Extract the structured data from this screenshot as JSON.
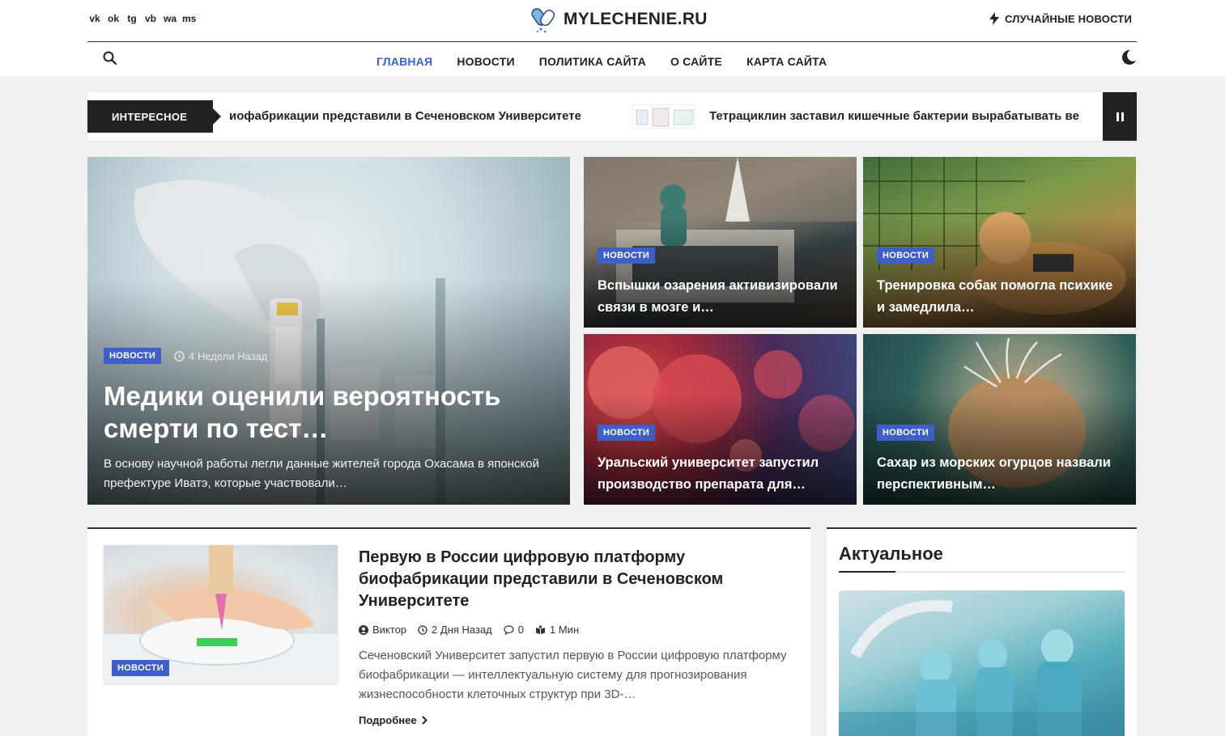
{
  "header": {
    "social_icons": [
      "vk-icon",
      "ok-icon",
      "telegram-icon",
      "viber-icon",
      "whatsapp-icon",
      "messenger-icon"
    ],
    "social_glyphs": [
      "vk",
      "ok",
      "tg",
      "vb",
      "wa",
      "ms"
    ],
    "logo_text": "MYLECHENIE.RU",
    "random_news": "СЛУЧАЙНЫЕ НОВОСТИ"
  },
  "nav": {
    "items": [
      "ГЛАВНАЯ",
      "НОВОСТИ",
      "ПОЛИТИКА САЙТА",
      "О САЙТЕ",
      "КАРТА САЙТА"
    ],
    "active_index": 0
  },
  "ticker": {
    "label": "ИНТЕРЕСНОЕ",
    "items": [
      "иофабрикации представили в Сеченовском Университете",
      "Тетрациклин заставил кишечные бактерии вырабатывать ве"
    ]
  },
  "hero": {
    "main": {
      "category": "НОВОСТИ",
      "time": "4 Недели Назад",
      "title": "Медики оценили вероятность смерти по тест…",
      "excerpt": "В основу научной работы легли данные жителей города Охасама в японской префектуре Иватэ, которые участвовали…"
    },
    "cards": [
      {
        "category": "НОВОСТИ",
        "title": "Вспышки озарения активизировали связи в мозге и…"
      },
      {
        "category": "НОВОСТИ",
        "title": "Тренировка собак помогла психике и замедлила…"
      },
      {
        "category": "НОВОСТИ",
        "title": "Уральский университет запустил производство препарата для…"
      },
      {
        "category": "НОВОСТИ",
        "title": "Сахар из морских огурцов назвали перспективным…"
      }
    ]
  },
  "post": {
    "category": "НОВОСТИ",
    "title": "Первую в России цифровую платформу биофабрикации представили в Сеченовском Университете",
    "author": "Виктор",
    "date": "2 Дня Назад",
    "comments": "0",
    "read_time": "1 Мин",
    "excerpt": "Сеченовский Университет запустил первую в России цифровую платформу биофабрикации — интеллектуальную систему для прогнозирования жизнеспособности клеточных структур при 3D-…",
    "more": "Подробнее"
  },
  "aside": {
    "title": "Актуальное"
  },
  "colors": {
    "accent": "#3d5fc7",
    "dark": "#222222",
    "background": "#f0f0f0"
  }
}
